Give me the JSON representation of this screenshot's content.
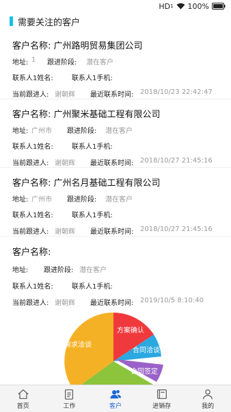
{
  "statusbar": {
    "network": "HD",
    "network_sup": "1",
    "battery": "100%"
  },
  "section": {
    "title": "需要关注的客户"
  },
  "labels": {
    "name": "客户名称:",
    "address": "地址:",
    "stage": "跟进阶段:",
    "contact_name": "联系人1姓名:",
    "contact_phone": "联系人1手机:",
    "owner": "当前跟进人:",
    "last_contact": "最近联系时间:"
  },
  "customers": [
    {
      "name": "广州路明贸易集团公司",
      "address": "1",
      "stage": "潜在客户",
      "owner": "谢朝辉",
      "last_contact": "2018/10/23 22:42:47"
    },
    {
      "name": "广州聚米基础工程有限公司",
      "address": "广州市",
      "stage": "潜在客户",
      "owner": "谢朝辉",
      "last_contact": "2018/10/27 21:45:16"
    },
    {
      "name": "广州名月基础工程有限公司",
      "address": "广州市",
      "stage": "潜在客户",
      "owner": "谢朝辉",
      "last_contact": "2018/10/27 21:45:16"
    },
    {
      "name": "",
      "address": "",
      "stage": "潜在客户",
      "owner": "谢朝辉",
      "last_contact": "2019/10/5 8:10:40"
    }
  ],
  "pie_chart": {
    "slices": [
      {
        "label": "需求洽谈",
        "color": "#f5b125"
      },
      {
        "label": "方案确认",
        "color": "#f0393c"
      },
      {
        "label": "合同洽谈",
        "color": "#2ca8e0"
      },
      {
        "label": "合同签定",
        "color": "#9a62c8"
      },
      {
        "label": "",
        "color": "#8cc43c"
      }
    ]
  },
  "tabbar": [
    {
      "label": "首页",
      "icon": "home-icon",
      "active": false
    },
    {
      "label": "工作",
      "icon": "clipboard-icon",
      "active": false
    },
    {
      "label": "客户",
      "icon": "users-icon",
      "active": true
    },
    {
      "label": "进销存",
      "icon": "book-icon",
      "active": false
    },
    {
      "label": "我的",
      "icon": "person-icon",
      "active": false
    }
  ],
  "colors": {
    "accent": "#16c1e6",
    "tab_active": "#1a66d8",
    "muted_value": "#9a9a9a"
  }
}
